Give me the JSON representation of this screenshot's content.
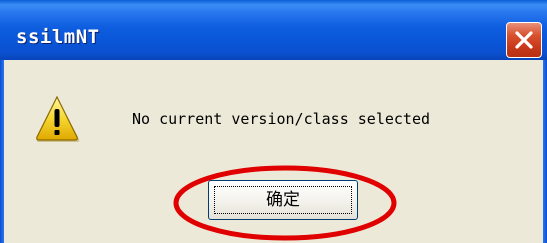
{
  "window": {
    "title": "ssilmNT",
    "close_icon": "close-icon",
    "titlebar_color": "#0a55d8",
    "close_button_color": "#c8391b"
  },
  "dialog": {
    "icon": "warning-icon",
    "message": "No current version/class selected",
    "ok_label": "确定"
  },
  "annotation": {
    "shape": "ellipse",
    "color": "#e00000",
    "target": "ok-button"
  }
}
